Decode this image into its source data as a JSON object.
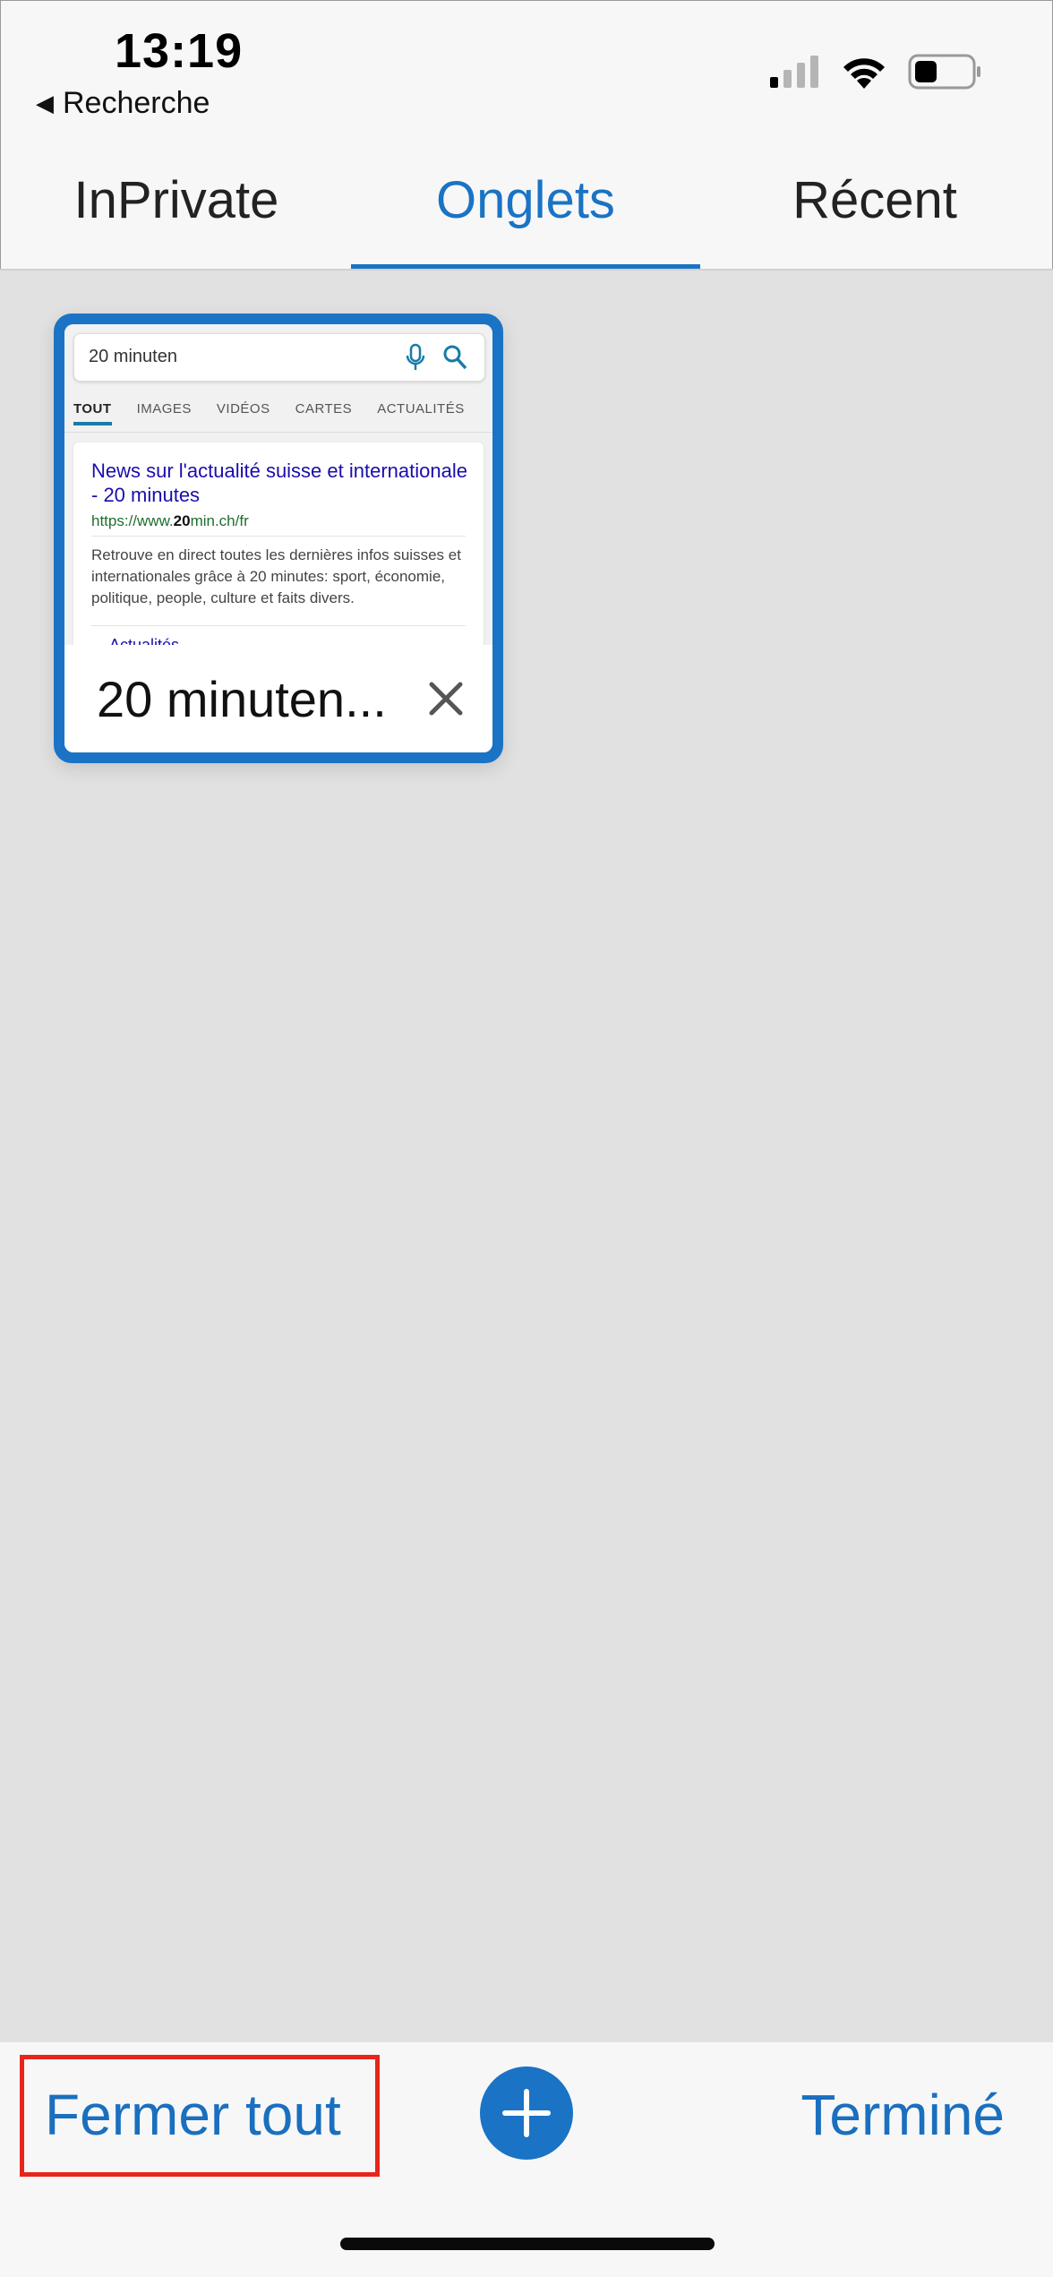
{
  "status_bar": {
    "time": "13:19",
    "back_label": "Recherche",
    "back_icon": "back-arrow-icon",
    "icons": [
      "signal-icon",
      "wifi-icon",
      "battery-icon"
    ]
  },
  "tabs": [
    {
      "label": "InPrivate",
      "active": false
    },
    {
      "label": "Onglets",
      "active": true
    },
    {
      "label": "Récent",
      "active": false
    }
  ],
  "tab_card": {
    "title": "20 minuten...",
    "preview": {
      "query": "20 minuten",
      "filters": [
        "TOUT",
        "IMAGES",
        "VIDÉOS",
        "CARTES",
        "ACTUALITÉS"
      ],
      "result_title": "News sur l'actualité suisse et internationale - 20 minutes",
      "result_url_prefix": "https://www.",
      "result_url_bold": "20",
      "result_url_suffix": "min.ch/fr",
      "result_desc": "Retrouve en direct toutes les dernières infos suisses et internationales grâce à 20 minutes: sport, économie, politique, people, culture et faits divers.",
      "result_more": "Actualités"
    }
  },
  "toolbar": {
    "close_all_label": "Fermer tout",
    "done_label": "Terminé",
    "add_icon": "plus-icon"
  },
  "colors": {
    "accent": "#1a73c5",
    "highlight": "#e8251a",
    "background": "#e1e1e1"
  }
}
